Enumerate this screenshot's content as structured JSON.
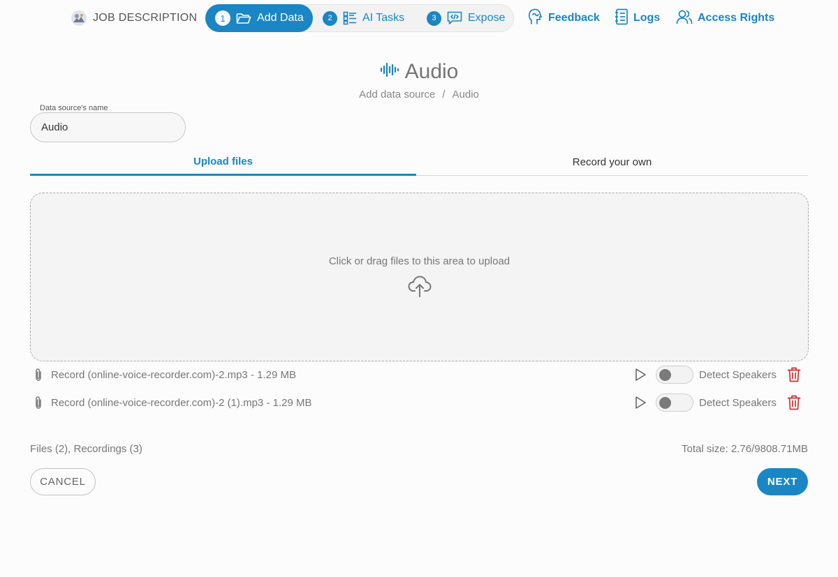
{
  "header": {
    "job_label": "JOB DESCRIPTION",
    "steps": [
      {
        "num": "1",
        "label": "Add Data",
        "icon": "folder-open-icon",
        "active": true
      },
      {
        "num": "2",
        "label": "AI Tasks",
        "icon": "list-icon",
        "active": false
      },
      {
        "num": "3",
        "label": "Expose",
        "icon": "code-chat-icon",
        "active": false
      }
    ],
    "links": {
      "feedback": "Feedback",
      "logs": "Logs",
      "access_rights": "Access Rights"
    }
  },
  "page": {
    "title": "Audio",
    "title_icon": "audio-waveform-icon",
    "breadcrumb": {
      "root": "Add data source",
      "separator": "/",
      "current": "Audio"
    }
  },
  "form": {
    "name_label": "Data source's name",
    "name_value": "Audio"
  },
  "tabs": {
    "upload": "Upload files",
    "record": "Record your own"
  },
  "dropzone": {
    "text": "Click or drag files to this area to upload",
    "icon": "cloud-upload-icon"
  },
  "files": [
    {
      "name": "Record (online-voice-recorder.com)-2.mp3 - 1.29 MB",
      "detect_label": "Detect Speakers",
      "detect_on": false
    },
    {
      "name": "Record (online-voice-recorder.com)-2 (1).mp3 - 1.29 MB",
      "detect_label": "Detect Speakers",
      "detect_on": false
    }
  ],
  "summary": {
    "counts": "Files (2), Recordings (3)",
    "total_size": "Total size: 2.76/9808.71MB"
  },
  "buttons": {
    "cancel": "CANCEL",
    "next": "NEXT"
  },
  "colors": {
    "accent": "#1a86c4",
    "danger": "#d32f2f"
  }
}
